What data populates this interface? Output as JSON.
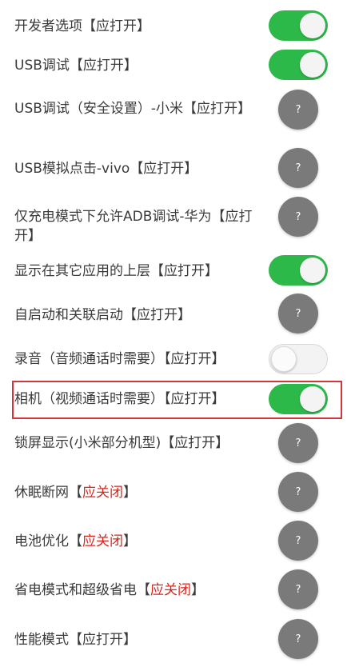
{
  "colors": {
    "toggle_on": "#2db84a",
    "toggle_off": "#f3f3f3",
    "help_button": "#7a7a7a",
    "warning_text": "#d8261e",
    "highlight_border": "#d3363a"
  },
  "rows": [
    {
      "label": "开发者选项【应打开】",
      "control": "toggle",
      "state": "on"
    },
    {
      "label": "USB调试【应打开】",
      "control": "toggle",
      "state": "on"
    },
    {
      "label": "USB调试（安全设置）-小米【应打开】",
      "control": "help",
      "help_text": "?"
    },
    {
      "label": "USB模拟点击-vivo【应打开】",
      "control": "help",
      "help_text": "?"
    },
    {
      "label": "仅充电模式下允许ADB调试-华为【应打开】",
      "control": "help",
      "help_text": "?"
    },
    {
      "label": "显示在其它应用的上层【应打开】",
      "control": "toggle",
      "state": "on"
    },
    {
      "label": "自启动和关联启动【应打开】",
      "control": "help",
      "help_text": "?"
    },
    {
      "label": "录音（音频通话时需要）【应打开】",
      "control": "toggle",
      "state": "off"
    },
    {
      "label": "相机（视频通话时需要）【应打开】",
      "control": "toggle",
      "state": "on",
      "highlighted": true
    },
    {
      "label": "锁屏显示(小米部分机型)【应打开】",
      "control": "help",
      "help_text": "?"
    },
    {
      "label_main": "休眠断网",
      "label_open": "【",
      "label_warn": "应关闭",
      "label_close": "】",
      "control": "help",
      "help_text": "?"
    },
    {
      "label_main": "电池优化",
      "label_open": "【",
      "label_warn": "应关闭",
      "label_close": "】",
      "control": "help",
      "help_text": "?"
    },
    {
      "label_main": "省电模式和超级省电",
      "label_open": "【",
      "label_warn": "应关闭",
      "label_close": "】",
      "control": "help",
      "help_text": "?"
    },
    {
      "label": "性能模式【应打开】",
      "control": "help",
      "help_text": "?"
    }
  ]
}
